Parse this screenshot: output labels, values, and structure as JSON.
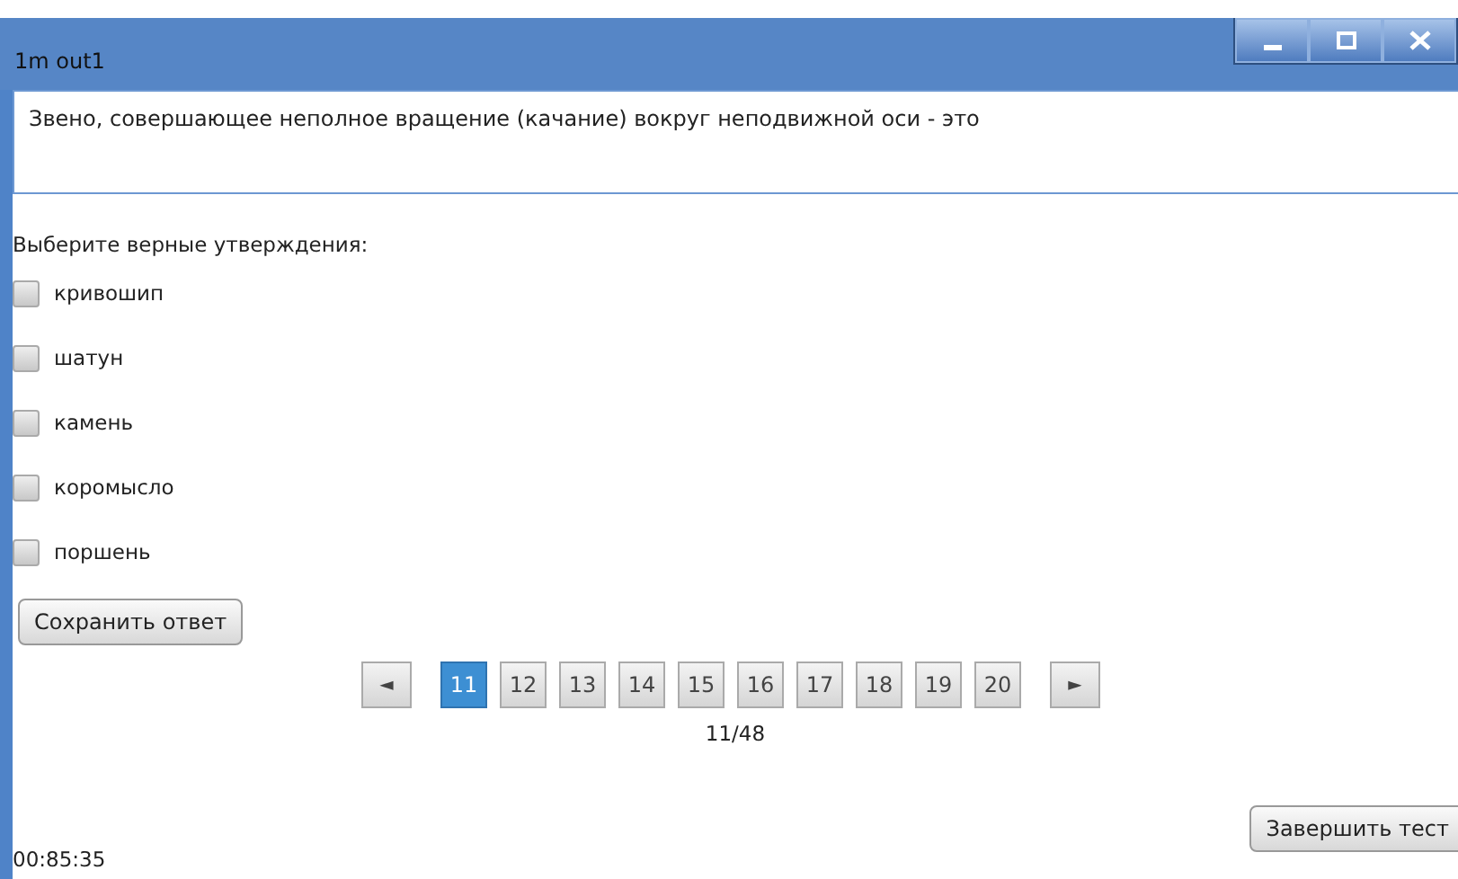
{
  "window": {
    "title": "1m out1",
    "controls": [
      {
        "kind": "minimize"
      },
      {
        "kind": "maximize"
      },
      {
        "kind": "close"
      }
    ]
  },
  "question": {
    "text": "Звено, совершающее неполное вращение (качание) вокруг неподвижной оси - это"
  },
  "prompt": "Выберите верные утверждения:",
  "options": [
    {
      "label": "кривошип",
      "checked": false
    },
    {
      "label": "шатун",
      "checked": false
    },
    {
      "label": "камень",
      "checked": false
    },
    {
      "label": "коромысло",
      "checked": false
    },
    {
      "label": "поршень",
      "checked": false
    }
  ],
  "save_button": "Сохранить ответ",
  "pagination": {
    "prev": "◄",
    "next": "►",
    "pages": [
      {
        "label": "11",
        "selected": true
      },
      {
        "label": "12",
        "selected": false
      },
      {
        "label": "13",
        "selected": false
      },
      {
        "label": "14",
        "selected": false
      },
      {
        "label": "15",
        "selected": false
      },
      {
        "label": "16",
        "selected": false
      },
      {
        "label": "17",
        "selected": false
      },
      {
        "label": "18",
        "selected": false
      },
      {
        "label": "19",
        "selected": false
      },
      {
        "label": "20",
        "selected": false
      }
    ],
    "counter": "11/48"
  },
  "finish_button": "Завершить тест",
  "timer": "00:85:35"
}
